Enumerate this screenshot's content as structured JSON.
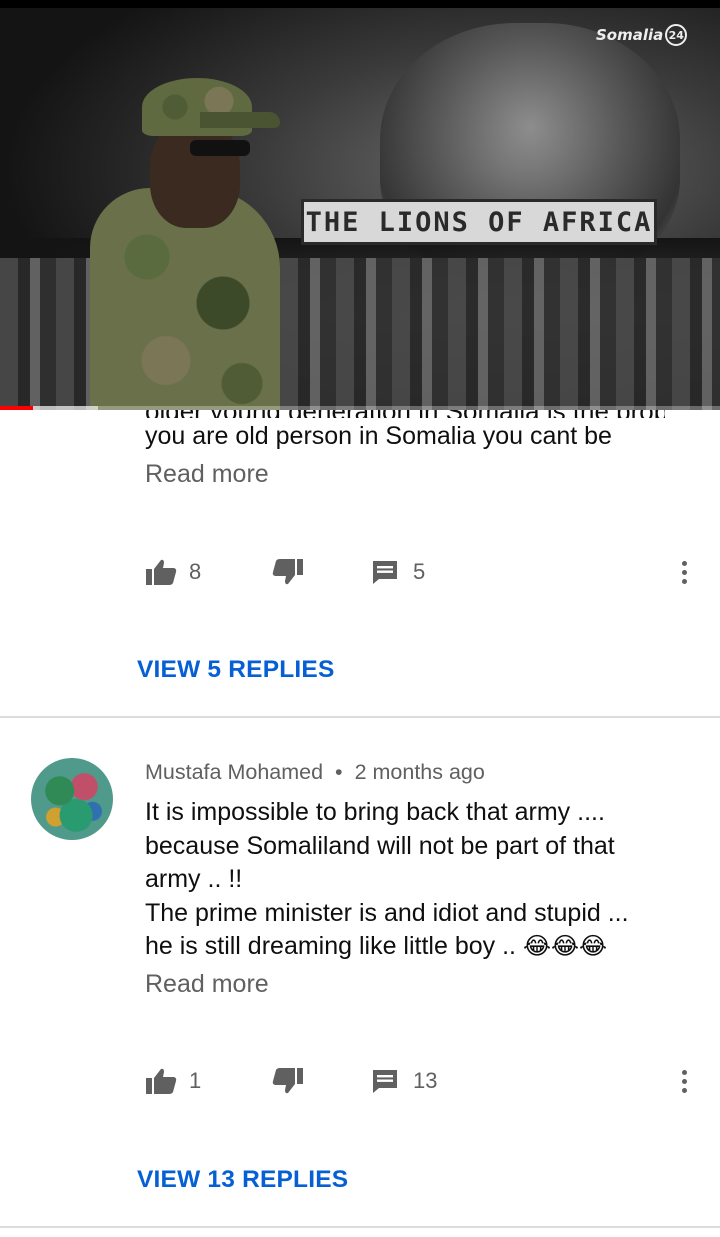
{
  "video": {
    "channel_logo": "Somalia",
    "channel_logo_badge": "24",
    "title_overlay": "THE LIONS OF AFRICA",
    "progress_fraction": 0.046,
    "buffer_fraction": 0.136
  },
  "comments": [
    {
      "partial_top_line": "older young generation in Somalia is the problem",
      "body": "you are old person in Somalia you cant be",
      "read_more": "Read more",
      "likes": "8",
      "replies_count": "5",
      "view_replies": "VIEW 5 REPLIES"
    },
    {
      "author": "Mustafa Mohamed",
      "separator": "•",
      "time": "2 months ago",
      "body": "It is impossible to bring back that army ....\nbecause Somaliland will not be part of that\narmy .. !!\nThe prime minister is and idiot and stupid ...\nhe is still dreaming like little boy .. ",
      "emoji": "😂😂😂",
      "read_more": "Read more",
      "likes": "1",
      "replies_count": "13",
      "view_replies": "VIEW 13 REPLIES"
    }
  ],
  "icons": {
    "like": "thumbs-up-icon",
    "dislike": "thumbs-down-icon",
    "reply": "comment-icon",
    "more": "more-vertical-icon"
  },
  "colors": {
    "link_blue": "#065fd4",
    "secondary_text": "#606060",
    "progress_red": "#ff0000"
  }
}
